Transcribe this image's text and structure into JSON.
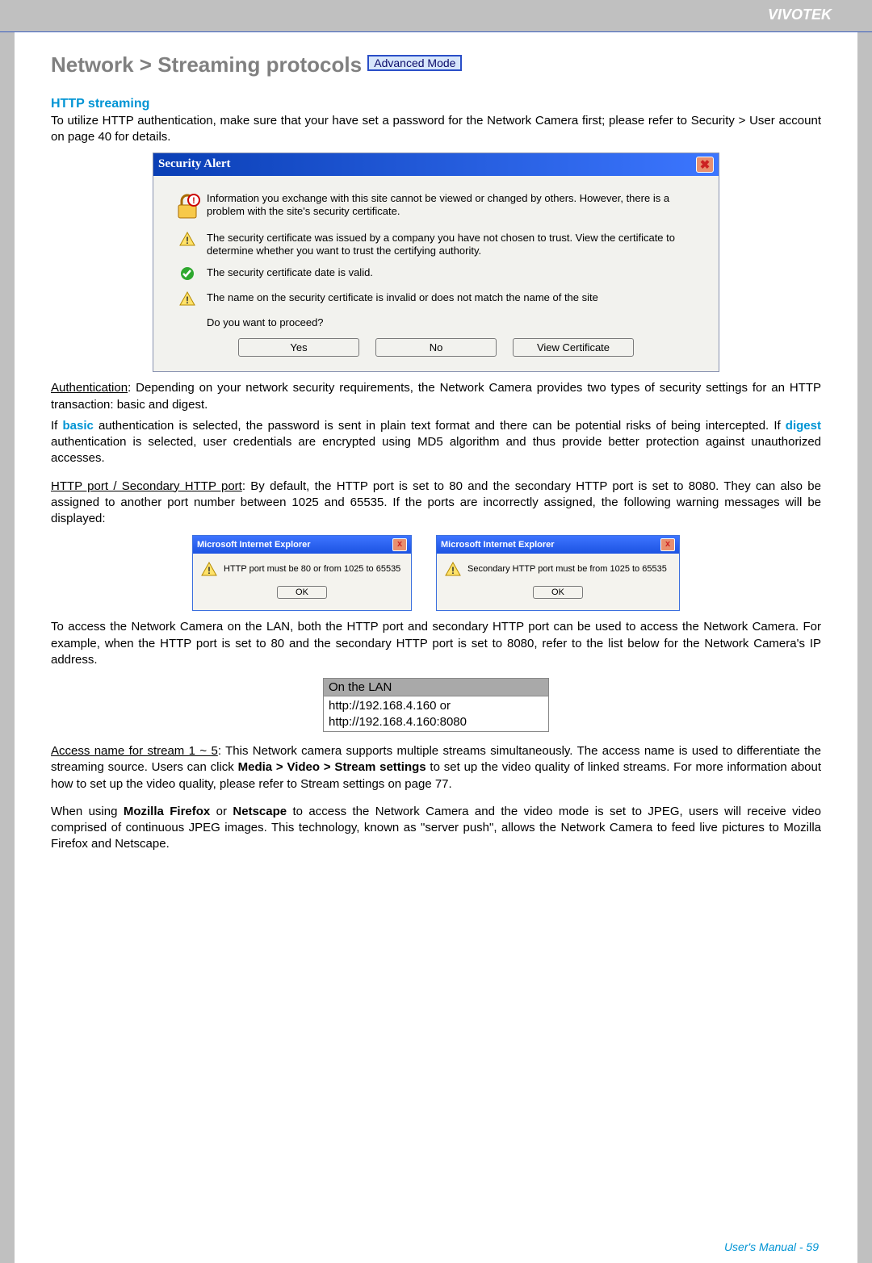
{
  "brand": "VIVOTEK",
  "page_title_prefix": "Network > Streaming protocols",
  "advanced_badge": "Advanced Mode",
  "http_heading": "HTTP streaming",
  "intro_para": "To utilize HTTP authentication, make sure that your have set a password for the Network Camera first; please refer to Security > User account on page 40 for details.",
  "alert": {
    "title": "Security Alert",
    "main": "Information you exchange with this site cannot be viewed or changed by others. However, there is a problem with the site's security certificate.",
    "line1": "The security certificate was issued by a company you have not chosen to trust. View the certificate to determine whether you want to trust the certifying authority.",
    "line2": "The security certificate date is valid.",
    "line3": "The name on the security certificate is invalid or does not match the name of the site",
    "proceed": "Do you want to proceed?",
    "yes": "Yes",
    "no": "No",
    "view": "View Certificate"
  },
  "auth_heading": "Authentication",
  "auth_para_1": ": Depending on your network security requirements, the Network Camera provides two types of security settings for an HTTP transaction: basic and digest.",
  "auth_para_2a": "If ",
  "auth_basic": "basic",
  "auth_para_2b": " authentication is selected, the password is sent in plain text format and there can be potential risks of being intercepted. If ",
  "auth_digest": "digest",
  "auth_para_2c": " authentication is selected, user credentials are encrypted using MD5 algorithm and thus provide better protection against unauthorized accesses.",
  "port_heading": "HTTP port / Secondary HTTP port",
  "port_para": ": By default, the HTTP port is set to 80 and the secondary HTTP port is set to 8080. They can also be assigned to another port number between 1025 and 65535. If the ports are incorrectly assigned, the following warning messages will be displayed:",
  "ie": {
    "title": "Microsoft Internet Explorer",
    "msg1": "HTTP port must be 80 or from 1025 to 65535",
    "msg2": "Secondary HTTP port must be from 1025 to 65535",
    "ok": "OK"
  },
  "access_para": "To access the Network Camera on the LAN, both the HTTP port and secondary HTTP port can be used to access the Network Camera. For example, when the HTTP port is set to 80 and the secondary HTTP port is set to 8080, refer to the list below for the Network Camera's IP address.",
  "lan": {
    "head": "On the LAN",
    "r1": "http://192.168.4.160  or",
    "r2": "http://192.168.4.160:8080"
  },
  "stream_heading": "Access name for stream 1 ~ 5",
  "stream_para_a": ": This Network camera supports multiple streams simultaneously. The access name is used to differentiate the streaming source. Users can click ",
  "stream_bold": "Media > Video > Stream settings",
  "stream_para_b": " to set up the video quality of linked streams. For more information about how to set up the video quality, please refer to Stream settings on page 77.",
  "firefox_para_a": "When using ",
  "firefox_bold1": "Mozilla Firefox",
  "firefox_or": " or ",
  "firefox_bold2": "Netscape",
  "firefox_para_b": " to access the Network Camera and the video mode is set to JPEG, users will receive video comprised of continuous JPEG images. This technology, known as \"server push\", allows the Network Camera to feed live pictures to Mozilla Firefox and Netscape.",
  "footer_label": "User's Manual - ",
  "footer_page": "59"
}
